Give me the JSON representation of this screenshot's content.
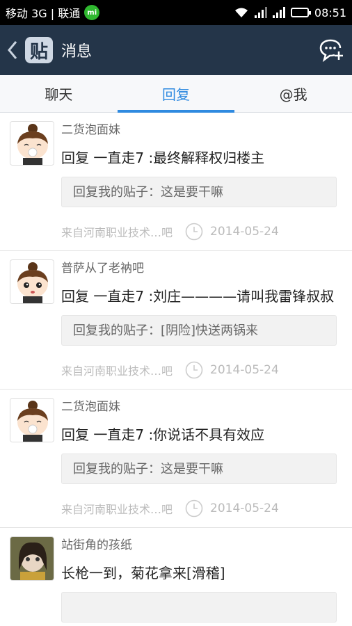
{
  "status": {
    "carrier": "移动 3G | 联通",
    "mi_label": "mi",
    "time": "08:51"
  },
  "header": {
    "logo_char": "贴",
    "title": "消息"
  },
  "tabs": [
    {
      "label": "聊天"
    },
    {
      "label": "回复"
    },
    {
      "label": "@我"
    }
  ],
  "active_tab": 1,
  "messages": [
    {
      "user": "二货泡面妹",
      "reply": "回复 一直走7 :最终解释权归楼主",
      "quote": "回复我的贴子：这是要干嘛",
      "source": "来自河南职业技术…吧",
      "date": "2014-05-24"
    },
    {
      "user": "普萨从了老衲吧",
      "reply": "回复 一直走7 :刘庄————请叫我雷锋叔叔",
      "quote": "回复我的贴子：[阴险]快送两锅来",
      "source": "来自河南职业技术…吧",
      "date": "2014-05-24"
    },
    {
      "user": "二货泡面妹",
      "reply": "回复 一直走7 :你说话不具有效应",
      "quote": "回复我的贴子：这是要干嘛",
      "source": "来自河南职业技术…吧",
      "date": "2014-05-24"
    },
    {
      "user": "站街角的孩纸",
      "reply": "长枪一到，菊花拿来[滑稽]",
      "quote": "",
      "source": "",
      "date": ""
    }
  ],
  "colors": {
    "accent": "#2f8ae0",
    "titlebar": "#243549"
  }
}
